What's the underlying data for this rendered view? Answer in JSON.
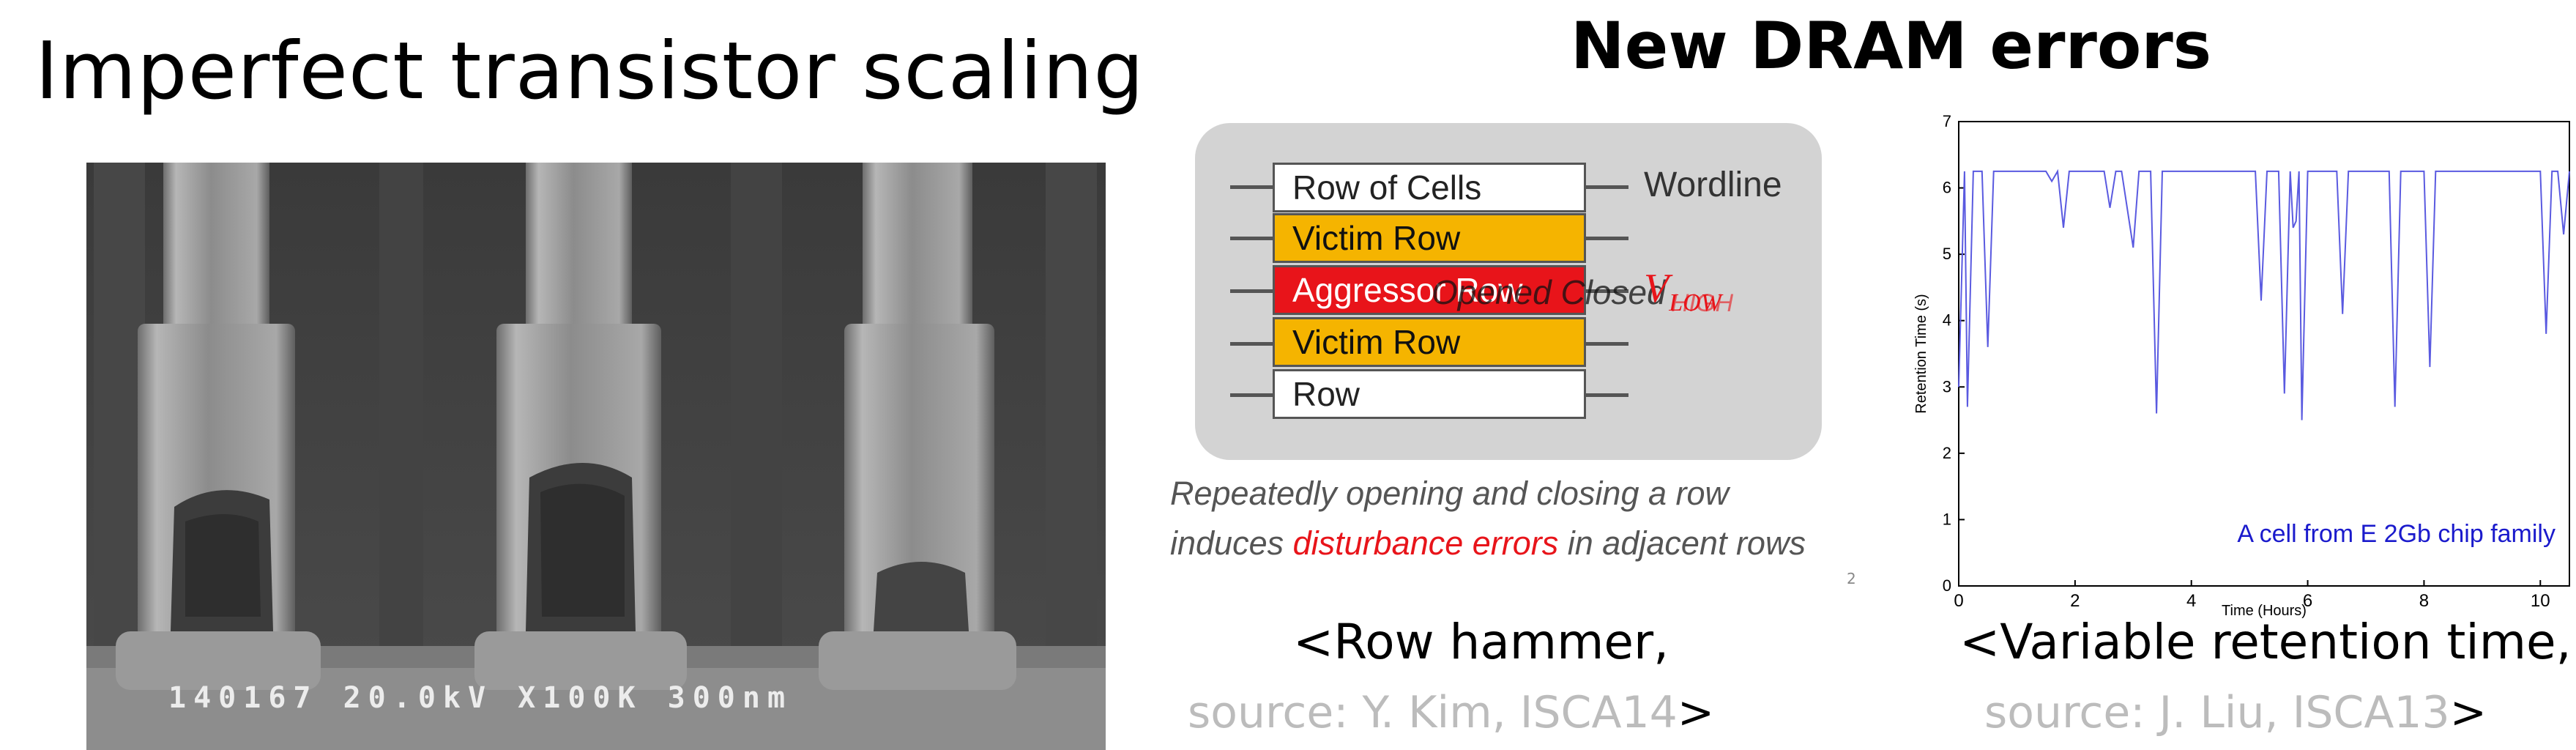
{
  "left_slide": {
    "title": "Imperfect transistor scaling",
    "photo_caption": "140167 20.0kV X100K 300nm"
  },
  "right_slide": {
    "title": "New DRAM errors",
    "row_hammer": {
      "rows": [
        "Row of Cells",
        "Victim Row",
        "Aggressor Row",
        "Victim Row",
        "Row"
      ],
      "aggressor_overlay": "Opened Closed",
      "wordline_label": "Wordline",
      "voltage_label": "V",
      "voltage_sub_low": "LOW",
      "voltage_sub_high": "HIGH",
      "caption_line1": "Repeatedly opening and closing a row",
      "caption_line2_pre": "induces ",
      "caption_line2_red": "disturbance errors",
      "caption_line2_post": " in adjacent rows",
      "slide_number": "2",
      "ref_line1": "<Row hammer,",
      "ref_source": "source: Y. Kim, ISCA14",
      "ref_close": ">"
    },
    "vrt": {
      "ref_line1": "<Variable retention time,",
      "ref_source": "source: J. Liu, ISCA13",
      "ref_close": ">"
    }
  },
  "chart_data": {
    "type": "line",
    "title": "",
    "xlabel": "Time (Hours)",
    "ylabel": "Retention Time (s)",
    "xlim": [
      0,
      10.5
    ],
    "ylim": [
      0,
      7
    ],
    "x_ticks": [
      0,
      2,
      4,
      6,
      8,
      10
    ],
    "y_ticks": [
      0,
      1,
      2,
      3,
      4,
      5,
      6,
      7
    ],
    "annotation": "A cell from E 2Gb chip family",
    "line_color": "#5a5ae0",
    "annotation_color": "#1a1acc",
    "series": [
      {
        "x": [
          0,
          0.1,
          0.15,
          0.25,
          0.4,
          0.5,
          0.6,
          1.5,
          1.6,
          1.7,
          1.8,
          1.9,
          2.5,
          2.6,
          2.7,
          2.8,
          3.0,
          3.1,
          3.2,
          3.3,
          3.4,
          3.5,
          3.6,
          3.7,
          5.0,
          5.1,
          5.2,
          5.3,
          5.4,
          5.5,
          5.6,
          5.7,
          5.75,
          5.8,
          5.85,
          5.9,
          6.0,
          6.1,
          6.2,
          6.3,
          6.5,
          6.6,
          6.7,
          6.8,
          6.9,
          7.0,
          7.1,
          7.2,
          7.3,
          7.4,
          7.5,
          7.6,
          8.0,
          8.1,
          8.2,
          8.3,
          8.4,
          8.5,
          8.6,
          8.7,
          8.8,
          8.9,
          9.0,
          9.1,
          9.2,
          9.3,
          9.4,
          9.5,
          9.6,
          9.7,
          10.0,
          10.1,
          10.2,
          10.3,
          10.4,
          10.5
        ],
        "y": [
          3.0,
          6.25,
          2.7,
          6.25,
          6.25,
          3.6,
          6.25,
          6.25,
          6.1,
          6.25,
          5.4,
          6.25,
          6.25,
          5.7,
          6.25,
          6.25,
          5.1,
          6.25,
          6.25,
          6.25,
          2.6,
          6.25,
          6.25,
          6.25,
          6.25,
          6.25,
          4.3,
          6.25,
          6.25,
          6.25,
          2.9,
          6.25,
          5.4,
          5.5,
          6.25,
          2.5,
          6.25,
          6.25,
          6.25,
          6.25,
          6.25,
          4.1,
          6.25,
          6.25,
          6.25,
          6.25,
          6.25,
          6.25,
          6.25,
          6.25,
          2.7,
          6.25,
          6.25,
          3.3,
          6.25,
          6.25,
          6.25,
          6.25,
          6.25,
          6.25,
          6.25,
          6.25,
          6.25,
          6.25,
          6.25,
          6.25,
          6.25,
          6.25,
          6.25,
          6.25,
          6.25,
          3.8,
          6.25,
          6.25,
          5.3,
          6.25
        ]
      }
    ]
  }
}
